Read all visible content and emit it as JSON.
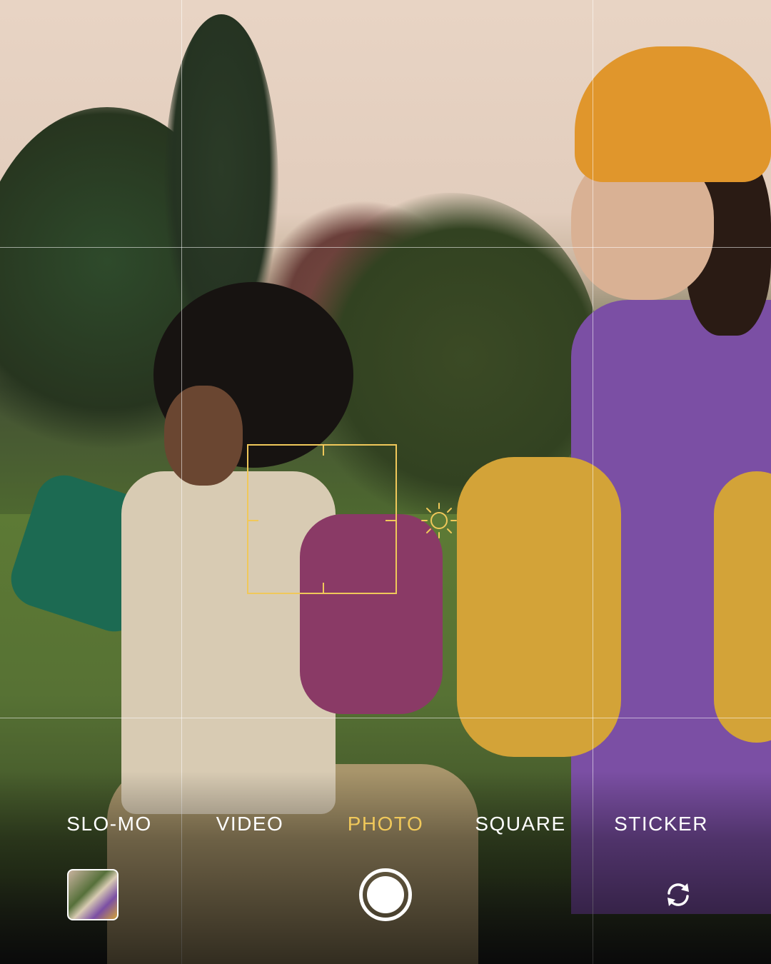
{
  "modes": {
    "items": [
      {
        "label": "SLO-MO"
      },
      {
        "label": "VIDEO"
      },
      {
        "label": "PHOTO"
      },
      {
        "label": "SQUARE"
      },
      {
        "label": "STICKER"
      }
    ],
    "active": "PHOTO"
  },
  "colors": {
    "accent": "#f0c85a",
    "label": "#ffffff",
    "grid": "#ffffff"
  },
  "icons": {
    "exposure": "sun-icon",
    "flip_camera": "camera-flip-icon",
    "shutter": "shutter-button",
    "gallery": "last-photo-thumbnail"
  }
}
